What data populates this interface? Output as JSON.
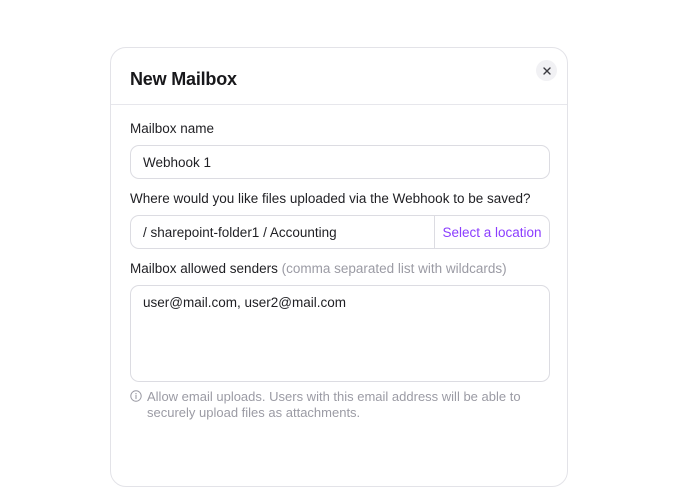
{
  "dialog": {
    "title": "New Mailbox",
    "close_icon": "close-icon"
  },
  "mailbox_name": {
    "label": "Mailbox name",
    "value": "Webhook 1"
  },
  "save_location": {
    "label": "Where would you like files uploaded via the Webhook to be saved?",
    "path": "/ sharepoint-folder1 / Accounting",
    "action_label": "Select a location",
    "accent_color": "#8b3dff"
  },
  "allowed_senders": {
    "label": "Mailbox allowed senders",
    "hint": "(comma separated list with wildcards)",
    "value": "user@mail.com, user2@mail.com",
    "helper_icon": "info-icon",
    "helper_text": "Allow email uploads. Users with this email address will be able to securely upload files as attachments."
  }
}
